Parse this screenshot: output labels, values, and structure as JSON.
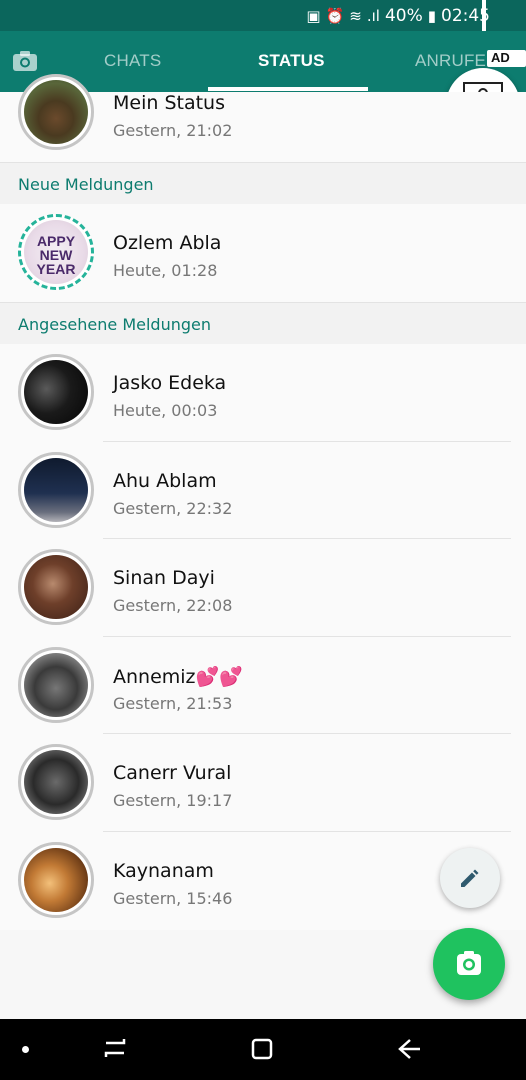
{
  "status_bar": {
    "battery": "40%",
    "time": "02:45",
    "icons": [
      "sim-icon",
      "alarm-icon",
      "wifi-icon",
      "signal-icon",
      "battery-icon"
    ]
  },
  "tabs": [
    {
      "label": "CHATS",
      "active": false
    },
    {
      "label": "STATUS",
      "active": true
    },
    {
      "label": "ANRUFE",
      "active": false
    }
  ],
  "ad": {
    "label": "AD",
    "arrow": "▷"
  },
  "my_status": {
    "name": "Mein Status",
    "time": "Gestern, 21:02"
  },
  "sections": {
    "new_updates": "Neue Meldungen",
    "viewed_updates": "Angesehene Meldungen"
  },
  "new_statuses": [
    {
      "name": "Ozlem Abla",
      "time": "Heute, 01:28"
    }
  ],
  "viewed_statuses": [
    {
      "name": "Jasko Edeka",
      "time": "Heute, 00:03"
    },
    {
      "name": "Ahu Ablam",
      "time": "Gestern, 22:32"
    },
    {
      "name": "Sinan Dayi",
      "time": "Gestern, 22:08"
    },
    {
      "name": "Annemiz💕💕",
      "time": "Gestern, 21:53"
    },
    {
      "name": "Canerr Vural",
      "time": "Gestern, 19:17"
    },
    {
      "name": "Kaynanam",
      "time": "Gestern, 15:46"
    }
  ],
  "colors": {
    "header": "#0d7c6f",
    "statusbar": "#0b665c",
    "accent": "#25b39a",
    "fab": "#1fc25f"
  }
}
